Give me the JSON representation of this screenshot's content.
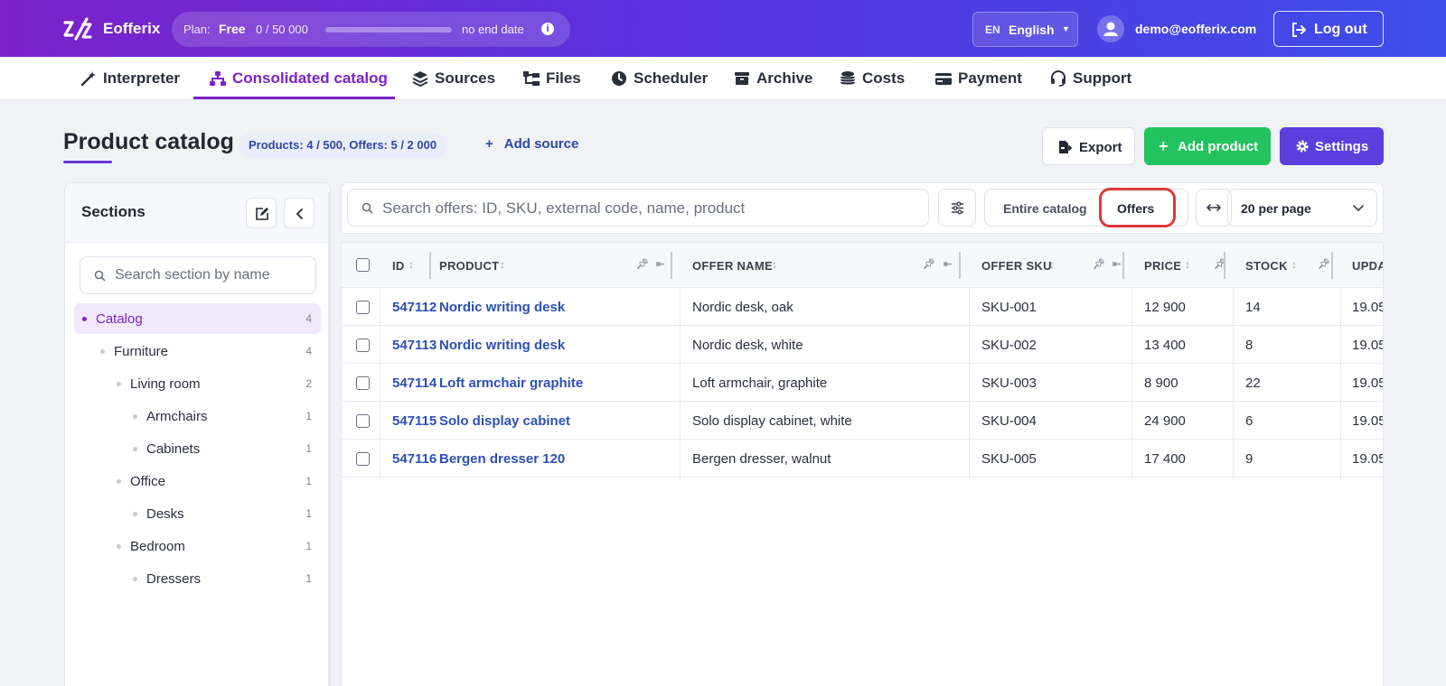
{
  "app": {
    "brand": "Eofferix",
    "plan_label": "Plan:",
    "plan_name": "Free",
    "plan_usage": "0  /  50 000",
    "plan_usage_fraction": 0,
    "plan_end": "no end date",
    "lang_code": "EN",
    "lang_name": "English",
    "user_email": "demo@eofferix.com",
    "logout_label": "Log out"
  },
  "nav": {
    "items": [
      {
        "label": "Interpreter",
        "icon": "wand-icon"
      },
      {
        "label": "Consolidated catalog",
        "icon": "sitemap-icon",
        "active": true
      },
      {
        "label": "Sources",
        "icon": "layers-icon"
      },
      {
        "label": "Files",
        "icon": "folder-tree-icon"
      },
      {
        "label": "Scheduler",
        "icon": "clock-icon"
      },
      {
        "label": "Archive",
        "icon": "archive-icon"
      },
      {
        "label": "Costs",
        "icon": "coins-icon"
      },
      {
        "label": "Payment",
        "icon": "credit-card-icon"
      },
      {
        "label": "Support",
        "icon": "headset-icon"
      }
    ]
  },
  "page": {
    "title": "Product catalog",
    "counts": "Products: 4 / 500, Offers: 5 / 2 000",
    "add_source": "Add source",
    "export_label": "Export",
    "add_product_label": "Add product",
    "settings_label": "Settings"
  },
  "sections": {
    "title": "Sections",
    "search_placeholder": "Search section by name",
    "tree": [
      {
        "label": "Catalog",
        "count": "4",
        "depth": 0,
        "active": true
      },
      {
        "label": "Furniture",
        "count": "4",
        "depth": 1
      },
      {
        "label": "Living room",
        "count": "2",
        "depth": 2
      },
      {
        "label": "Armchairs",
        "count": "1",
        "depth": 3
      },
      {
        "label": "Cabinets",
        "count": "1",
        "depth": 3
      },
      {
        "label": "Office",
        "count": "1",
        "depth": 2
      },
      {
        "label": "Desks",
        "count": "1",
        "depth": 3
      },
      {
        "label": "Bedroom",
        "count": "1",
        "depth": 2
      },
      {
        "label": "Dressers",
        "count": "1",
        "depth": 3
      }
    ]
  },
  "toolbar": {
    "search_placeholder": "Search offers: ID, SKU, external code, name, product",
    "scope_entire": "Entire catalog",
    "scope_offers": "Offers",
    "per_page": "20 per page"
  },
  "table": {
    "columns": [
      "ID",
      "PRODUCT",
      "OFFER NAME",
      "OFFER SKU",
      "PRICE",
      "STOCK",
      "UPDA"
    ],
    "rows": [
      {
        "id": "547112",
        "product": "Nordic writing desk",
        "offer_name": "Nordic desk, oak",
        "sku": "SKU-001",
        "price": "12 900",
        "stock": "14",
        "updated": "19.05"
      },
      {
        "id": "547113",
        "product": "Nordic writing desk",
        "offer_name": "Nordic desk, white",
        "sku": "SKU-002",
        "price": "13 400",
        "stock": "8",
        "updated": "19.05"
      },
      {
        "id": "547114",
        "product": "Loft armchair graphite",
        "offer_name": "Loft armchair, graphite",
        "sku": "SKU-003",
        "price": "8 900",
        "stock": "22",
        "updated": "19.05"
      },
      {
        "id": "547115",
        "product": "Solo display cabinet",
        "offer_name": "Solo display cabinet, white",
        "sku": "SKU-004",
        "price": "24 900",
        "stock": "6",
        "updated": "19.05"
      },
      {
        "id": "547116",
        "product": "Bergen dresser 120",
        "offer_name": "Bergen dresser, walnut",
        "sku": "SKU-005",
        "price": "17 400",
        "stock": "9",
        "updated": "19.05"
      }
    ]
  },
  "colors": {
    "accent_purple": "#7b22c9",
    "link_blue": "#2d4fb8",
    "add_green": "#22c35e",
    "settings_violet": "#5b3fdc",
    "highlight_red": "#e0383c"
  }
}
